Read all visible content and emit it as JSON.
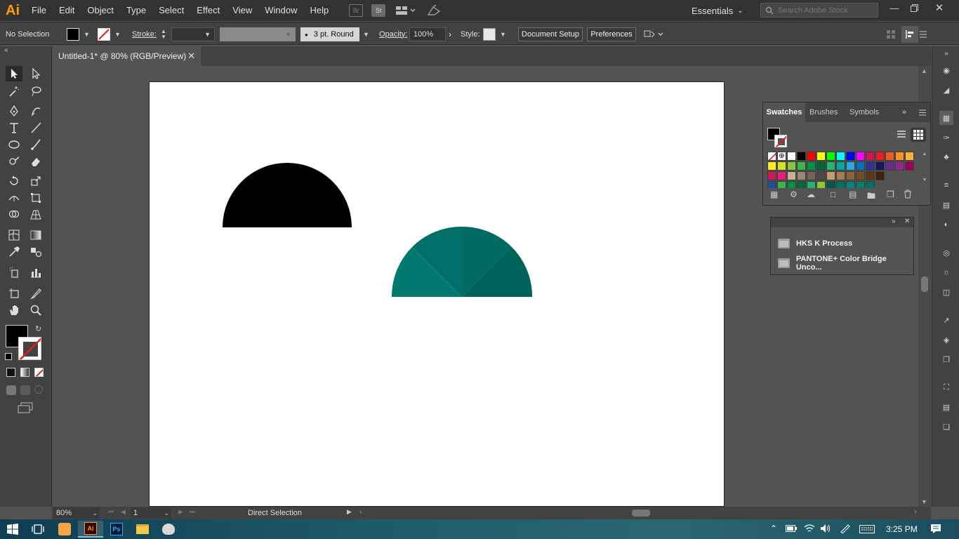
{
  "app": {
    "logo": "Ai"
  },
  "menu": [
    "File",
    "Edit",
    "Object",
    "Type",
    "Select",
    "Effect",
    "View",
    "Window",
    "Help"
  ],
  "menubar_icons": {
    "bridge": "Br",
    "stock": "St"
  },
  "workspace": {
    "label": "Essentials"
  },
  "search": {
    "placeholder": "Search Adobe Stock"
  },
  "control_bar": {
    "selection": "No Selection",
    "stroke_label": "Stroke:",
    "brush": "3 pt. Round",
    "opacity_label": "Opacity:",
    "opacity_value": "100%",
    "style_label": "Style:",
    "document_setup": "Document Setup",
    "preferences": "Preferences"
  },
  "document": {
    "tab_title": "Untitled-1* @ 80% (RGB/Preview)"
  },
  "swatches_panel": {
    "tabs": [
      "Swatches",
      "Brushes",
      "Symbols"
    ],
    "active_tab": "Swatches",
    "colors": {
      "row1": [
        "#ffffff",
        "#000000",
        "#ff0000",
        "#ffff00",
        "#00ff00",
        "#00ffff",
        "#0000ff",
        "#ff00ff",
        "#d4145a",
        "#ed1c24",
        "#f15a24",
        "#f7931e",
        "#fbb03b"
      ],
      "row2": [
        "#fcee21",
        "#d9e021",
        "#8cc63f",
        "#39b54a",
        "#009245",
        "#006837",
        "#22b573",
        "#00a99d",
        "#29abe2",
        "#0071bc",
        "#2e3192",
        "#1b1464",
        "#662d91",
        "#93278f",
        "#9e005d"
      ],
      "row3": [
        "#d4145a",
        "#ed1e79",
        "#c7b299",
        "#998675",
        "#736357",
        "#534741",
        "#c69c6d",
        "#a67c52",
        "#8c6239",
        "#754c24",
        "#603813",
        "#42210b"
      ],
      "row4": [
        "#1b4f9e",
        "#39b54a",
        "#009245",
        "#006837",
        "#22b573",
        "#8cc63f",
        "#005b4f",
        "#00715f",
        "#00827f",
        "#007f73",
        "#006e6a"
      ]
    }
  },
  "libraries_panel": {
    "items": [
      "HKS K Process",
      "PANTONE+ Color Bridge Unco..."
    ]
  },
  "artwork": {
    "black_semicircle": {
      "fill": "#000000"
    },
    "teal_semicircle": {
      "colors": [
        "#007a70",
        "#006f67",
        "#00635a"
      ]
    }
  },
  "statusbar": {
    "zoom": "80%",
    "page": "1",
    "tool_name": "Direct Selection"
  },
  "taskbar": {
    "time": "3:25 PM"
  }
}
